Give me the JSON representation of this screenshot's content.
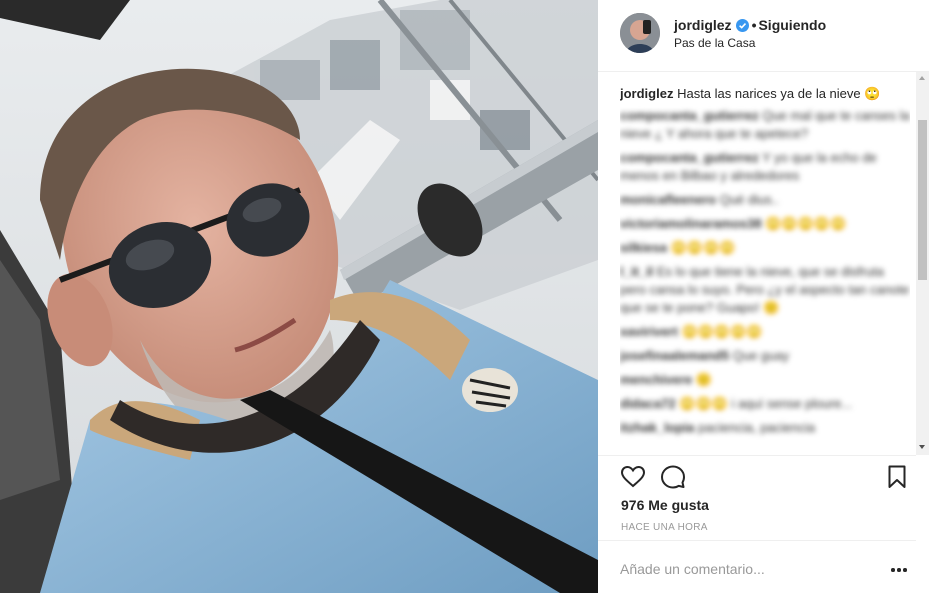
{
  "post": {
    "username": "jordiglez",
    "follow_status": "Siguiendo",
    "separator": "•",
    "location": "Pas de la Casa"
  },
  "caption": {
    "username": "jordiglez",
    "text": "Hasta las narices ya de la nieve 🙄"
  },
  "comments": [
    {
      "username": "compocanta_gutierrez",
      "text": "Que mal que te canses la nieve ¿ Y ahora que te apetece?"
    },
    {
      "username": "compocanta_gutierrez",
      "text": "Y yo que la echo de menos en Bilbao y alrededores"
    },
    {
      "username": "monicafleenero",
      "text": "Qué dius.."
    },
    {
      "username": "victoriamolinaramos38",
      "text": "🙄🙄🙄🙄🙄"
    },
    {
      "username": "silkiesa",
      "text": "🙄🙄🙄🙄"
    },
    {
      "username": "l_it_il",
      "text": "Es lo que tiene la nieve, que se disfruta pero cansa lo suyo. Pero ¿y el aspecto tan canote que se te pone? Guapo! 🙂"
    },
    {
      "username": "xavirivert",
      "text": "🙄🙄🙄🙄🙄"
    },
    {
      "username": "josefinaalemand5",
      "text": "Que guay"
    },
    {
      "username": "menchivere",
      "text": "🙂"
    },
    {
      "username": "didaca72",
      "text": "🙄🙄🙄 i aquí sense ploure..."
    },
    {
      "username": "itzhak_lopia",
      "text": "paciencia, paciencia"
    }
  ],
  "stats": {
    "likes": "976 Me gusta",
    "time": "HACE UNA HORA"
  },
  "add_comment": {
    "placeholder": "Añade un comentario..."
  },
  "icons": {
    "like": "heart-icon",
    "comment": "comment-bubble-icon",
    "save": "bookmark-icon",
    "more": "more-options-icon",
    "verified": "verified-badge-icon"
  },
  "colors": {
    "verified": "#3897f0",
    "jacket": "#8fb8d8",
    "text": "#262626",
    "muted": "#999999"
  }
}
